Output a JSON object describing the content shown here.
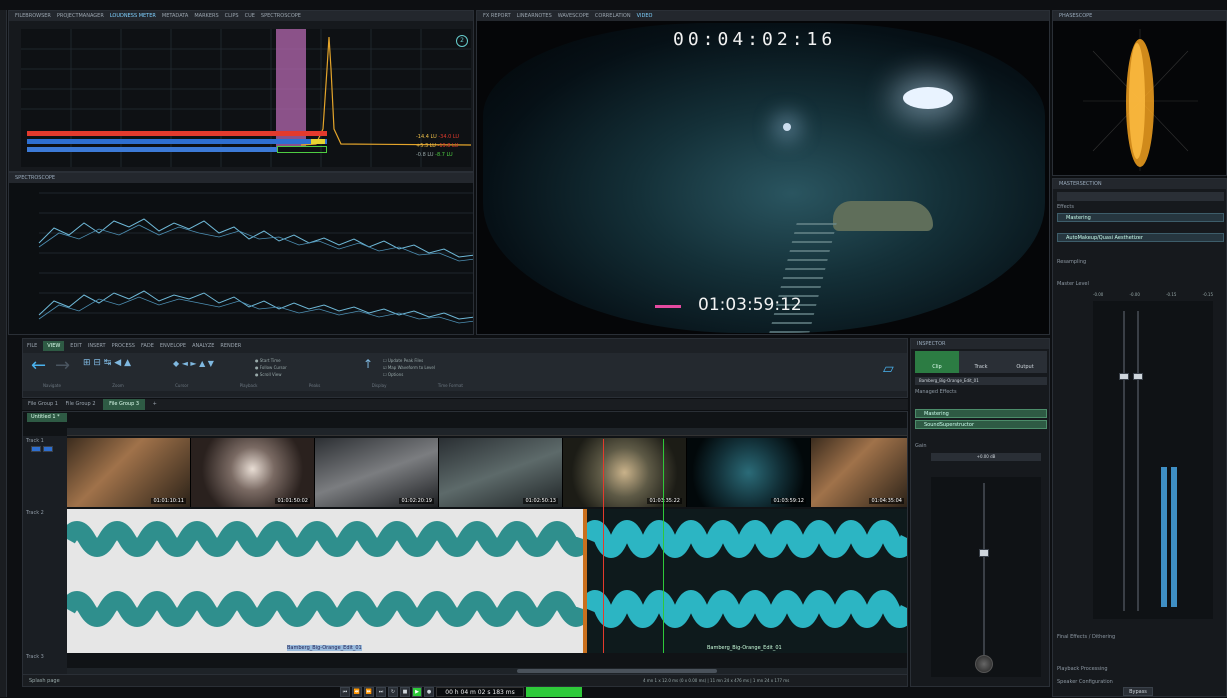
{
  "top_tabs": {
    "analysis": [
      "FILEBROWSER",
      "PROJECTMANAGER",
      "LOUDNESS METER",
      "METADATA",
      "MARKERS",
      "CLIPS",
      "CUE",
      "SPECTROSCOPE"
    ],
    "video": [
      "FX REPORT",
      "LINEARNOTES",
      "WAVESCOPE",
      "CORRELATION",
      "VIDEO"
    ]
  },
  "loudness": {
    "values": [
      "-14.4 LU",
      "+5.3 LU",
      "-0.8 LU"
    ],
    "values_red": [
      "-34.0 LU",
      "-19.8 LU",
      "-8.7 LU"
    ]
  },
  "spectroscope": {
    "title": "SPECTROSCOPE"
  },
  "video": {
    "timecode_top": "00:04:02:16",
    "timecode_burn": "01:03:59:12"
  },
  "phasescope": {
    "title": "PHASESCOPE"
  },
  "mastersection": {
    "title": "MASTERSECTION",
    "effects_label": "Effects",
    "effects": [
      "Mastering",
      "AutoMakeup/Quasi Aesthetizer"
    ],
    "resampling_label": "Resampling",
    "master_level_label": "Master Level",
    "level_ticks": [
      "-0.00",
      "-0.00",
      "-0.15",
      "-0.15"
    ],
    "final_effects_label": "Final Effects / Dithering",
    "playback_label": "Playback Processing",
    "speaker_label": "Speaker Configuration",
    "bypass_label": "Bypass"
  },
  "ribbon": {
    "tabs": [
      "FILE",
      "VIEW",
      "EDIT",
      "INSERT",
      "PROCESS",
      "FADE",
      "ENVELOPE",
      "ANALYZE",
      "RENDER"
    ],
    "active_tab": "VIEW",
    "group_labels": [
      "Navigate",
      "Zoom",
      "Cursor",
      "Playback",
      "Peaks",
      "Display",
      "Time Format"
    ]
  },
  "file_tabs": [
    "File Group 1",
    "File Group 2",
    "File Group 3"
  ],
  "editor": {
    "tab": "Untitled 1 *",
    "clip_name_1": "Bamberg_Big-Orange_Edit_01",
    "clip_name_2": "Bamberg_Big-Orange_Edit_01",
    "thumb_times": [
      "01:01:10:11",
      "01:01:50:02",
      "01:02:20:19",
      "01:02:50:13",
      "01:03:35:22",
      "01:03:59:12",
      "01:04:35:04"
    ],
    "track_labels": [
      "Track 1",
      "Track 2",
      "Track 3"
    ]
  },
  "inspector": {
    "title": "INSPECTOR",
    "tabs": [
      "Clip",
      "Track",
      "Output"
    ],
    "clip_name": "Bamberg_Big-Orange_Edit_01",
    "managed_label": "Managed Effects",
    "effects": [
      "Mastering",
      "SoundSuperstructor"
    ],
    "gain_label": "Gain",
    "gain_value": "+0.00 dB"
  },
  "transport": {
    "time": "00 h 04 m 02 s 183 ms"
  },
  "status": {
    "left": "Splash page",
    "right_segments": [
      "4 mn 1 x 12.0 ms (0 x 0.00 ms)",
      "11 mn 24 x 476 ms",
      "1 mn 24 x 177 ms",
      "4 x 1 (10)",
      "48 kHz (Stereo 4K 1024 ms)"
    ]
  },
  "colors": {
    "accent": "#3fb3c4",
    "wave_left": "#2f8f8d",
    "wave_right": "#2cb5c3",
    "play_green": "#2ec93a",
    "phasescope_orange": "#f4a21e"
  }
}
